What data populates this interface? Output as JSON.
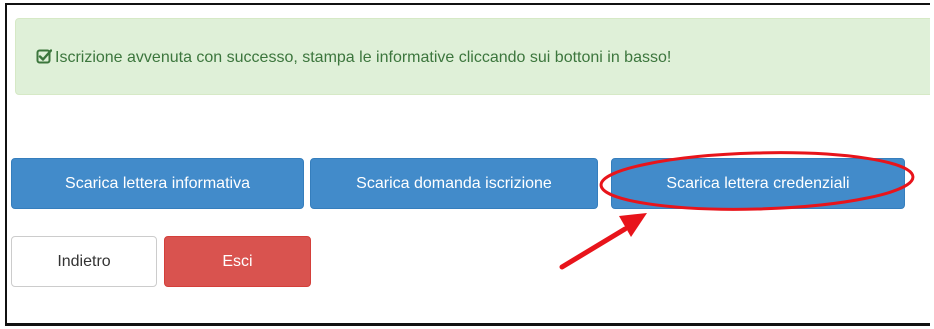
{
  "alert": {
    "icon": "check-square-icon",
    "message": "Iscrizione avvenuta con successo, stampa le informative cliccando sui bottoni in basso!",
    "color": "#3c763d",
    "background": "#dff0d8"
  },
  "downloads": {
    "informativa_label": "Scarica lettera informativa",
    "domanda_label": "Scarica domanda iscrizione",
    "credenziali_label": "Scarica lettera credenziali",
    "color": "#428bca"
  },
  "actions": {
    "back_label": "Indietro",
    "exit_label": "Esci",
    "exit_color": "#d9534f"
  },
  "annotation": {
    "highlight_color": "#e8141b",
    "highlights": "credenziali-button"
  }
}
